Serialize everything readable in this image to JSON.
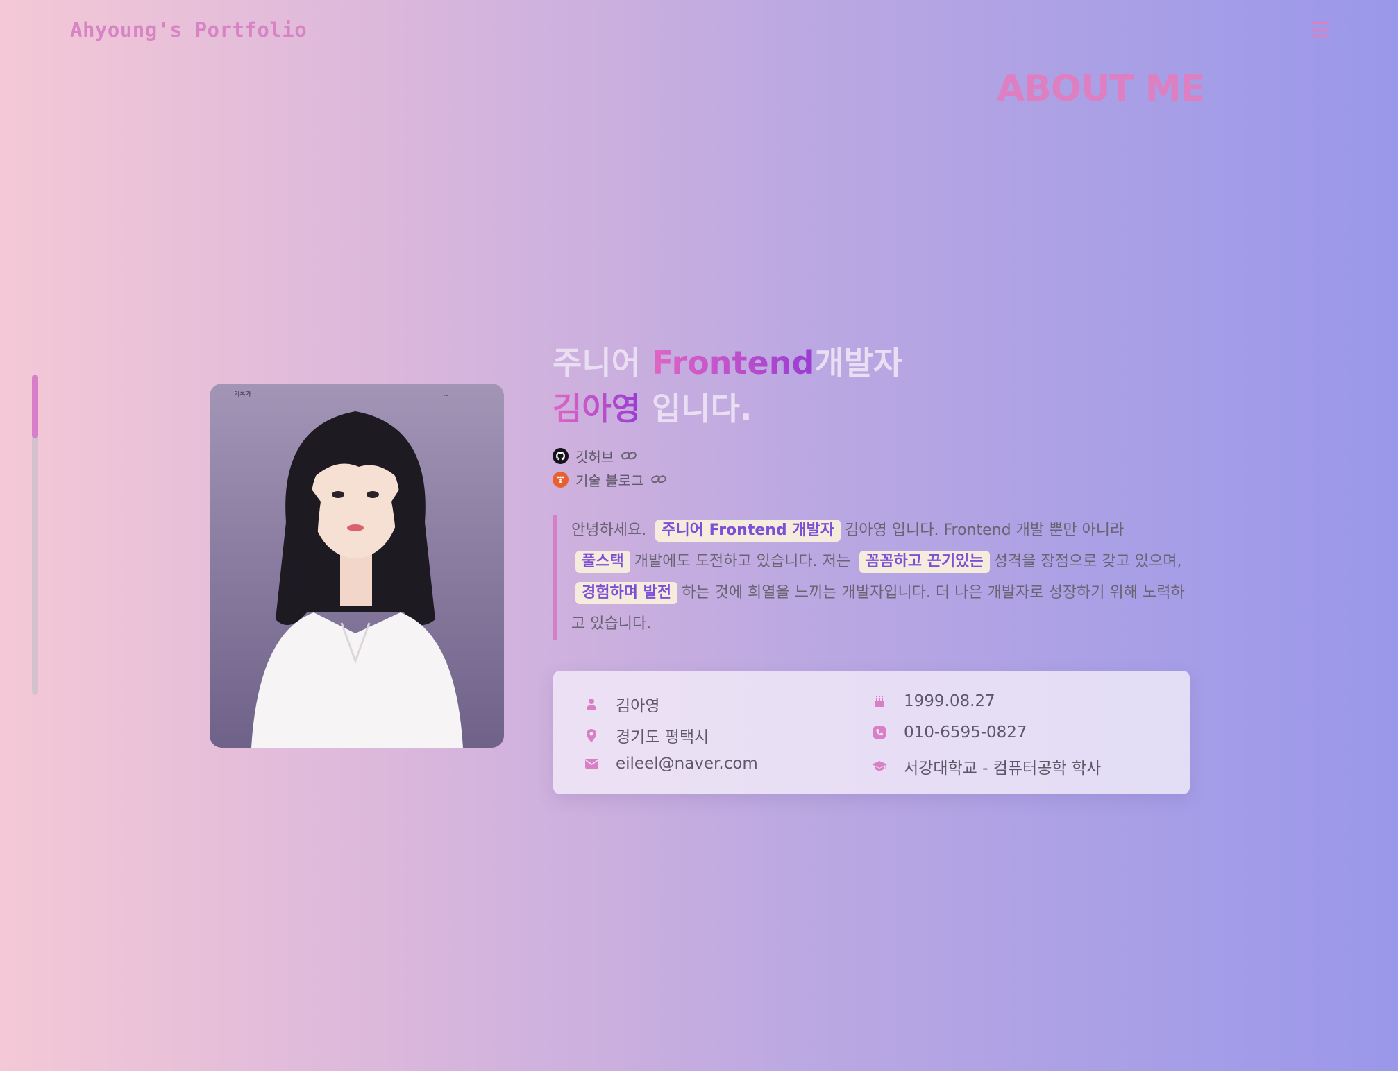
{
  "header": {
    "logo": "Ahyoung's Portfolio",
    "menu_icon": "hamburger-menu-icon"
  },
  "section": {
    "title": "ABOUT ME"
  },
  "scrollbar": {
    "progress": 0.15
  },
  "profile": {
    "photo_icon": "profile-photo",
    "headline": {
      "part1": "주니어 ",
      "part2": "Frontend",
      "part3": "개발자",
      "name": "김아영",
      "suffix": " 입니다."
    },
    "links": [
      {
        "label": "깃허브",
        "icon": "github-icon"
      },
      {
        "label": "기술 블로그",
        "icon": "blog-icon"
      }
    ],
    "intro": {
      "t1": "안녕하세요.",
      "tag1": "주니어 Frontend 개발자",
      "t2": "김아영 입니다. Frontend 개발 뿐만 아니라",
      "tag2": "풀스택",
      "t3": "개발에도 도전하고 있습니다. 저는",
      "tag3": "꼼꼼하고 끈기있는",
      "t4": "성격을 장점으로 갖고 있으며,",
      "tag4": "경험하며 발전",
      "t5": "하는 것에 희열을 느끼는 개발자입니다. 더 나은 개발자로 성장하기 위해 노력하고 있습니다."
    },
    "info": {
      "name": "김아영",
      "birth": "1999.08.27",
      "location": "경기도 평택시",
      "phone": "010-6595-0827",
      "email": "eileel@naver.com",
      "education": "서강대학교 - 컴퓨터공학 학사"
    }
  },
  "colors": {
    "accent": "#de7fc1",
    "tag_text": "#7b4fd6",
    "tag_bg": "#f6ecde"
  }
}
